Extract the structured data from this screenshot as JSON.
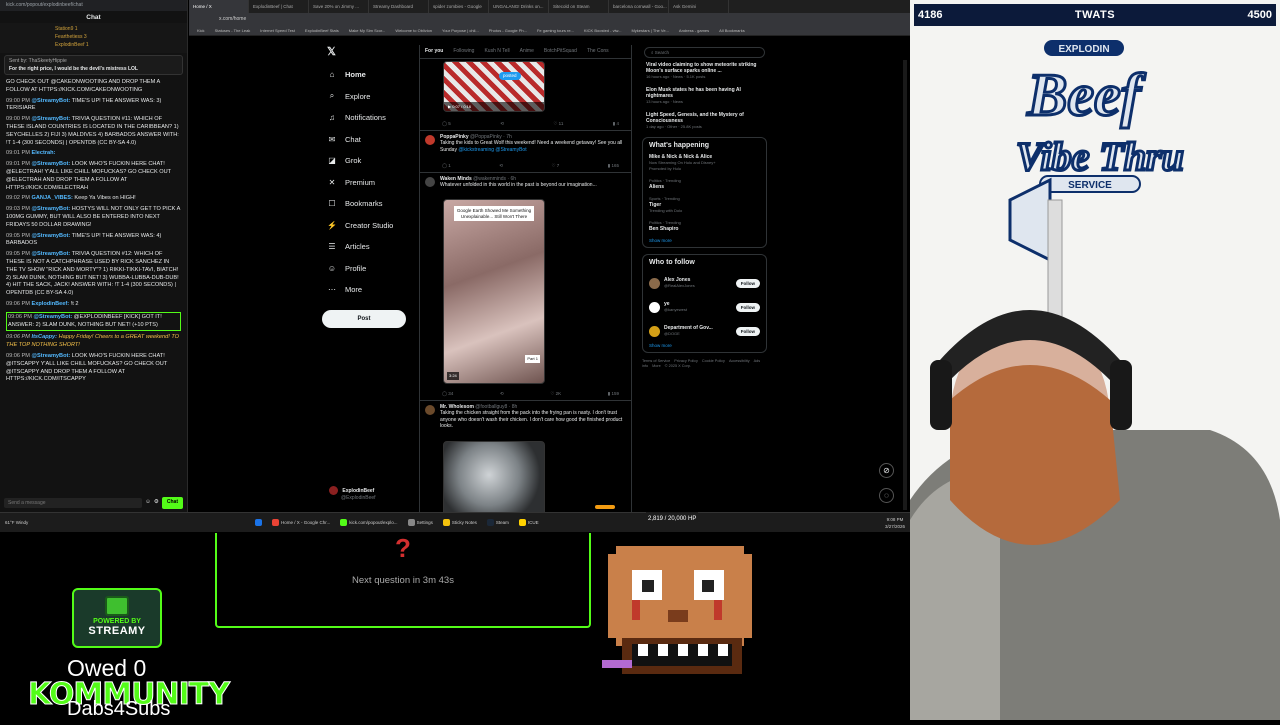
{
  "chat": {
    "url": "kick.com/popout/explodinbeef/chat",
    "title": "Chat",
    "cheer_names": [
      "Station9",
      "Fearthetiess",
      "ExplodinBeef"
    ],
    "cheer_counts": [
      "1",
      "3",
      "1"
    ],
    "pinned_by": "Sent by: ThaSkeetyHippie",
    "pinned_text": "For the right price, I would be the devil's mistress LOL",
    "messages": [
      {
        "time": "",
        "user": "",
        "text": "GO CHECK OUT @CAKEONWOOTING AND DROP THEM A FOLLOW AT HTTPS://KICK.COM/CAKEONWOOTING",
        "style": ""
      },
      {
        "time": "09:00 PM",
        "user": "@StreamyBot:",
        "text": "TIME'S UP! THE ANSWER WAS: 3) TERISIARE",
        "style": ""
      },
      {
        "time": "09:00 PM",
        "user": "@StreamyBot:",
        "text": "TRIVIA QUESTION #11: WHICH OF THESE ISLAND COUNTRIES IS LOCATED IN THE CARIBBEAN? 1) SEYCHELLES 2) FIJI 3) MALDIVES 4) BARBADOS ANSWER WITH: !T 1-4 (300 SECONDS) | OPENTDB (CC BY-SA 4.0)",
        "style": ""
      },
      {
        "time": "09:01 PM",
        "user": "Electrah:",
        "text": "",
        "style": ""
      },
      {
        "time": "09:01 PM",
        "user": "@StreamyBot:",
        "text": "LOOK WHO'S FUCKIN HERE CHAT! @ELECTRAH! Y'ALL LIKE CHILL MOFUCKAS? GO CHECK OUT @ELECTRAH AND DROP THEM A FOLLOW AT HTTPS://KICK.COM/ELECTRAH",
        "style": ""
      },
      {
        "time": "09:02 PM",
        "user": "GANJA_VIBES:",
        "text": "Keep Ya Vibes on HIGH!",
        "style": ""
      },
      {
        "time": "09:03 PM",
        "user": "@StreamyBot:",
        "text": "HOSTYS WILL NOT ONLY GET TO PICK A 100MG GUMMY, BUT WILL ALSO BE ENTERED INTO NEXT FRIDAYS 50 DOLLAR DRAWING!",
        "style": ""
      },
      {
        "time": "09:05 PM",
        "user": "@StreamyBot:",
        "text": "TIME'S UP! THE ANSWER WAS: 4) BARBADOS",
        "style": ""
      },
      {
        "time": "09:05 PM",
        "user": "@StreamyBot:",
        "text": "TRIVIA QUESTION #12: WHICH OF THESE IS NOT A CATCHPHRASE USED BY RICK SANCHEZ IN THE TV SHOW \"RICK AND MORTY\"? 1) RIKKI-TIKKI-TAVI, BIATCH! 2) SLAM DUNK, NOTHING BUT NET! 3) WUBBA-LUBBA-DUB-DUB! 4) HIT THE SACK, JACK! ANSWER WITH: !T 1-4 (300 SECONDS) | OPENTDB (CC BY-SA 4.0)",
        "style": ""
      },
      {
        "time": "09:06 PM",
        "user": "ExplodinBeef:",
        "text": "!t 2",
        "style": ""
      },
      {
        "time": "09:06 PM",
        "user": "@StreamyBot:",
        "text": "@EXPLODINBEEF [KICK] GOT IT! ANSWER: 2) SLAM DUNK, NOTHING BUT NET! (+10 PTS)",
        "style": "hl"
      },
      {
        "time": "09:06 PM",
        "user": "ItsCappy:",
        "text": "Happy Friday! Cheers to a GREAT weekend! TO THE TOP NOTHING SHORT!",
        "style": "it"
      },
      {
        "time": "09:06 PM",
        "user": "@StreamyBot:",
        "text": "LOOK WHO'S FUCKIN HERE CHAT! @ITSCAPPY Y'ALL LIKE CHILL MOFUCKAS? GO CHECK OUT @ITSCAPPY AND DROP THEM A FOLLOW AT HTTPS://KICK.COM/ITSCAPPY",
        "style": ""
      }
    ],
    "input_placeholder": "Send a message",
    "chat_button": "Chat"
  },
  "browser": {
    "tabs": [
      "Home / X",
      "ExplodinBeef | Chat",
      "Save 20% on Jimmy ...",
      "Streamy Dashboard",
      "spider zombies - Google",
      "UNGALANG! Drinks on...",
      "Sitecold on Steam",
      "barcelona cornwall - Goo...",
      "Ask Gemini"
    ],
    "address": "x.com/home",
    "bookmarks": [
      "Kick",
      "Statuses - The Leak",
      "Internet Speed Test",
      "ExplodinBeef Stats",
      "Make My Sim Scor...",
      "Welcome to Oblivion",
      "Your Purpose | chil...",
      "Photos - Google Ph...",
      "Fe gaming tours re...",
      "KICK Boosted - viw...",
      "Mykestars | The Ve...",
      "Andress - games",
      "All Bookmarks"
    ]
  },
  "x": {
    "nav": [
      {
        "icon": "⌂",
        "label": "Home",
        "name": "home"
      },
      {
        "icon": "⌕",
        "label": "Explore",
        "name": "explore"
      },
      {
        "icon": "♫",
        "label": "Notifications",
        "name": "notifications"
      },
      {
        "icon": "✉",
        "label": "Chat",
        "name": "chat"
      },
      {
        "icon": "◪",
        "label": "Grok",
        "name": "grok"
      },
      {
        "icon": "✕",
        "label": "Premium",
        "name": "premium"
      },
      {
        "icon": "☐",
        "label": "Bookmarks",
        "name": "bookmarks"
      },
      {
        "icon": "⚡",
        "label": "Creator Studio",
        "name": "creator-studio"
      },
      {
        "icon": "☰",
        "label": "Articles",
        "name": "articles"
      },
      {
        "icon": "☺",
        "label": "Profile",
        "name": "profile"
      },
      {
        "icon": "⋯",
        "label": "More",
        "name": "more"
      }
    ],
    "post_button": "Post",
    "me_name": "ExplodinBeef",
    "me_handle": "@ExplodinBeef",
    "feed_tabs": [
      "For you",
      "Following",
      "Kush N Tell",
      "Anime",
      "BotchPitSquad",
      "The Cons"
    ],
    "posts": [
      {
        "name": "",
        "handle": "",
        "text": "",
        "stats": [
          "5",
          "",
          "11",
          "4"
        ]
      },
      {
        "name": "PoppaPinky",
        "handle": "@PoppaPinky · 7h",
        "text": "Taking the kids to Great Wolf this weekend! Need a weekend getaway! See you all Sunday ",
        "link": "@kickstreaming @StreamyBot",
        "stats": [
          "1",
          "",
          "7",
          "165"
        ]
      },
      {
        "name": "Waken Minds",
        "handle": "@wakenminds · 6h",
        "text": "Whatever unfolded in this world in the past is beyond our imagination...",
        "media_text": "Google Earth Showed Me Something Unexplainable... Still Won't There",
        "media_time": "3:24",
        "part": "Part 1",
        "stats": [
          "34",
          "",
          "2K",
          "159"
        ]
      },
      {
        "name": "Mr. Wholesom",
        "handle": "@footballguy8 · 8h",
        "text": "Taking the chicken straight from the pack into the frying pan is nasty. I don't trust anyone who doesn't wash their chicken. I don't care how good the finished product looks. ",
        "stats": []
      }
    ],
    "video_time": "0:07 / 0:16",
    "posted_label": "posted",
    "search_placeholder": "Search",
    "news": [
      {
        "title": "Viral video claiming to show meteorite striking Moon's surface sparks online ...",
        "meta": "16 hours ago · News · 5.1K posts"
      },
      {
        "title": "Elon Musk states he has been having AI nightmares",
        "meta": "13 hours ago · News"
      },
      {
        "title": "Light Speed, Genesis, and the Mystery of Consciousness",
        "meta": "1 day ago · Other · 25.8K posts"
      }
    ],
    "happening_title": "What's happening",
    "trends": [
      {
        "cat": "Mike & Nick & Nick & Alice",
        "name": "",
        "sub": "Now Streaming On Hulu and Disney+",
        "promo": "Promoted by Hulu"
      },
      {
        "cat": "Politics · Trending",
        "name": "Aliens",
        "sub": ""
      },
      {
        "cat": "Sports · Trending",
        "name": "Tiger",
        "sub": "Trending with Dolo"
      },
      {
        "cat": "Politics · Trending",
        "name": "Ben Shapiro",
        "sub": ""
      }
    ],
    "show_more": "Show more",
    "who_title": "Who to follow",
    "follow": [
      {
        "name": "Alex Jones",
        "handle": "@RealAlexJones",
        "btn": "Follow"
      },
      {
        "name": "ye",
        "handle": "@kanyewest",
        "btn": "Follow"
      },
      {
        "name": "Department of Gov...",
        "handle": "@DOGE",
        "btn": "Follow"
      }
    ],
    "footer": [
      "Terms of Service",
      "Privacy Policy",
      "Cookie Policy",
      "Accessibility",
      "Ads info",
      "More",
      "© 2025 X Corp."
    ]
  },
  "taskbar": {
    "weather": "61°F Windy",
    "apps": [
      "Home / X - Google Chr...",
      "kick.com/popout/explo...",
      "Settings",
      "Sticky Notes",
      "Steam",
      "ICUE"
    ],
    "time": "9:08 PM",
    "date": "3/27/2026"
  },
  "overlay": {
    "top_left_number": "4186",
    "top_title": "TWATS",
    "top_right_number": "4500",
    "trivia_icon": "?",
    "next_question": "Next question in 3m 43s",
    "hp_text": "2,819 / 20,000 HP",
    "owed": "Owed 0",
    "kommunity": "KOMMUNITY",
    "dabs": "Dabs4Subs",
    "badge_top": "POWERED BY",
    "badge_main": "STREAMY",
    "logo_top": "EXPLODIN",
    "logo_main": "Beef",
    "logo_sub": "Vibe Thru",
    "logo_service": "SERVICE",
    "colors": {
      "kick_green": "#53fc18",
      "x_blue": "#1d9bf0",
      "bar_navy": "#0c1a3a",
      "question_red": "#d32f2f"
    }
  }
}
